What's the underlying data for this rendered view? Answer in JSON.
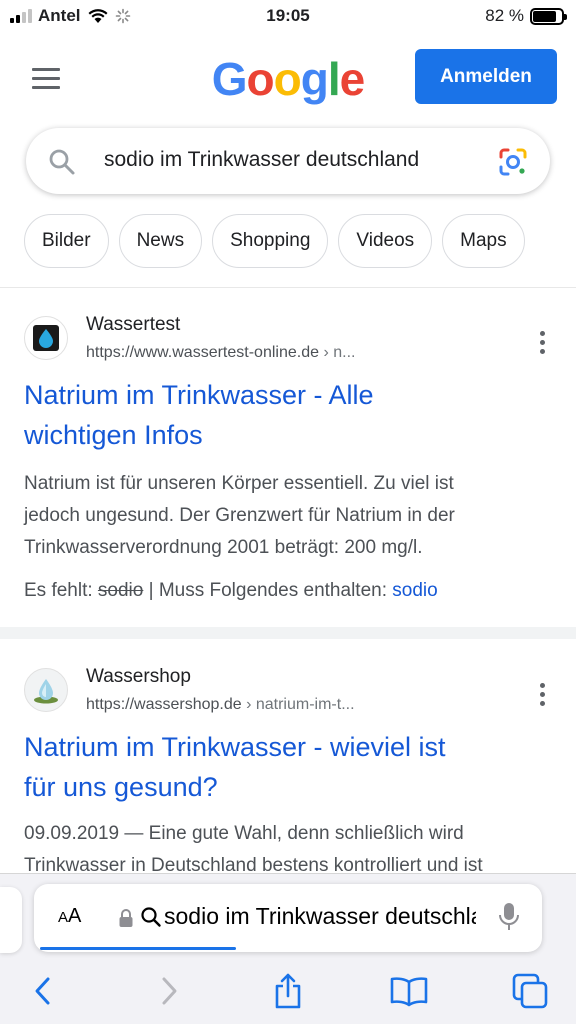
{
  "status_bar": {
    "carrier": "Antel",
    "time": "19:05",
    "battery": "82 %",
    "battery_level": 0.82
  },
  "header": {
    "logo": [
      "G",
      "o",
      "o",
      "g",
      "l",
      "e"
    ],
    "signin_label": "Anmelden"
  },
  "search": {
    "query": "sodio im Trinkwasser deutschland"
  },
  "chips": [
    "Bilder",
    "News",
    "Shopping",
    "Videos",
    "Maps"
  ],
  "results": [
    {
      "site": "Wassertest",
      "url": "https://www.wassertest-online.de",
      "crumb": " › n...",
      "title_line1": "Natrium im Trinkwasser - Alle",
      "title_line2": "wichtigen Infos",
      "snippet_lines": [
        "Natrium ist für unseren Körper essentiell. Zu viel ist",
        "jedoch ungesund. Der Grenzwert für Natrium in der",
        "Trinkwasserverordnung 2001 beträgt: 200 mg/l."
      ],
      "missing_prefix": "Es fehlt: ",
      "missing_struck": "sodio",
      "missing_middle": " | Muss Folgendes enthalten: ",
      "missing_term": "sodio"
    },
    {
      "site": "Wassershop",
      "url": "https://wassershop.de",
      "crumb": " › natrium-im-t...",
      "title_line1": "Natrium im Trinkwasser - wieviel ist",
      "title_line2": "für uns gesund?",
      "snippet_lines": [
        "09.09.2019 — Eine gute Wahl, denn schließlich wird",
        "Trinkwasser in Deutschland bestens kontrolliert und ist"
      ]
    }
  ],
  "safari": {
    "text_size_label": "AA",
    "address_text": "sodio im Trinkwasser deutschland"
  },
  "colors": {
    "accent": "#1a73e8",
    "link": "#1558d6"
  }
}
